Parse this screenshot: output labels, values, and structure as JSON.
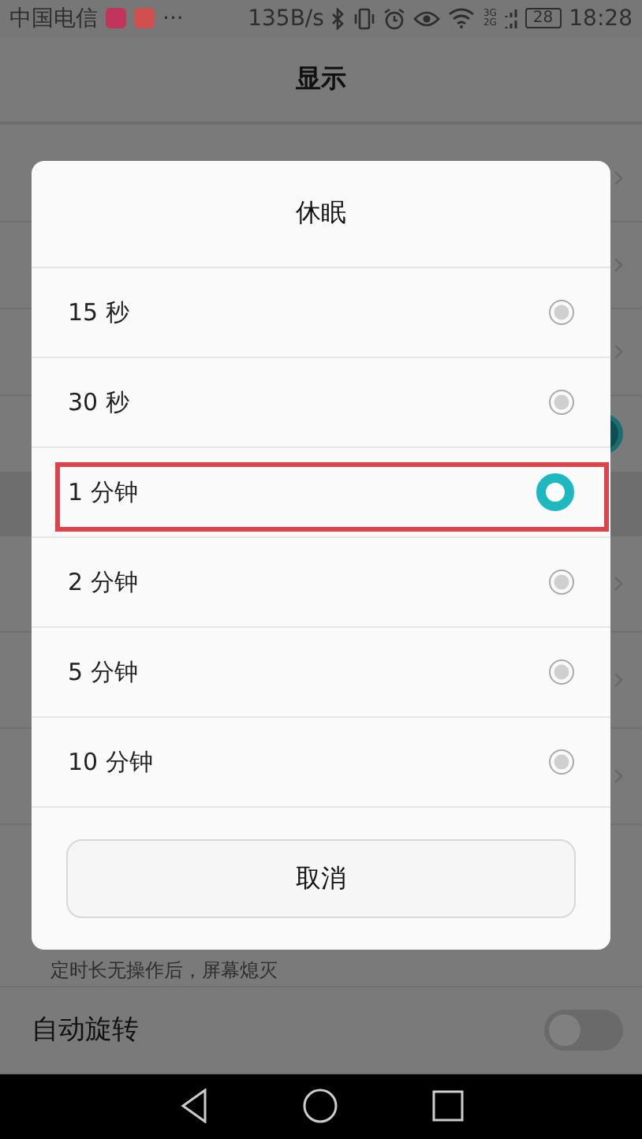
{
  "status_bar": {
    "carrier": "中国电信",
    "more": "···",
    "speed": "135B/s",
    "net_top": "3G",
    "net_bottom": "2G",
    "battery": "28",
    "time": "18:28"
  },
  "header": {
    "title": "显示"
  },
  "settings": [
    {
      "kind": "chevron"
    },
    {
      "kind": "chevron"
    },
    {
      "kind": "chevron"
    },
    {
      "kind": "toggle",
      "on": true
    },
    {
      "kind": "band"
    },
    {
      "kind": "chevron"
    },
    {
      "kind": "chevron"
    },
    {
      "kind": "chevron"
    },
    {
      "kind": "hint",
      "text": "定时长无操作后，屏幕熄灭"
    },
    {
      "kind": "toggle_label",
      "label": "自动旋转",
      "on": false
    }
  ],
  "dialog": {
    "title": "休眠",
    "options": [
      {
        "label": "15 秒",
        "selected": false,
        "highlighted": false
      },
      {
        "label": "30 秒",
        "selected": false,
        "highlighted": false
      },
      {
        "label": "1 分钟",
        "selected": true,
        "highlighted": true
      },
      {
        "label": "2 分钟",
        "selected": false,
        "highlighted": false
      },
      {
        "label": "5 分钟",
        "selected": false,
        "highlighted": false
      },
      {
        "label": "10 分钟",
        "selected": false,
        "highlighted": false
      }
    ],
    "cancel": "取消"
  }
}
